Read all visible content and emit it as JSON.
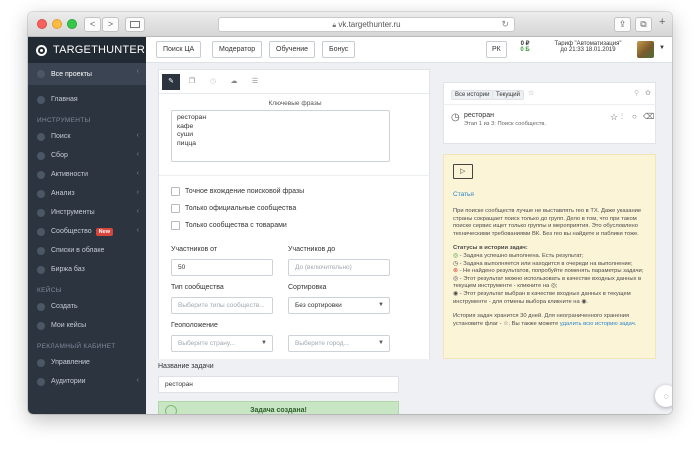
{
  "browser": {
    "url": "vk.targethunter.ru",
    "nav_back": "<",
    "nav_forward": ">",
    "share_glyph": "⇪",
    "tabs_glyph": "⧉",
    "plus": "+"
  },
  "sidebar": {
    "logo": "TARGETHUNTER",
    "all_projects": "Все проекты",
    "home": "Главная",
    "tools_head": "ИНСТРУМЕНТЫ",
    "items": [
      "Поиск",
      "Сбор",
      "Активности",
      "Анализ",
      "Инструменты",
      "Сообщество",
      "Списки в облаке",
      "Биржа баз"
    ],
    "new_badge": "New",
    "cases_head": "КЕЙСЫ",
    "create": "Создать",
    "my_cases": "Мои кейсы",
    "ads_head": "РЕКЛАМНЫЙ КАБИНЕТ",
    "manage": "Управление",
    "audiences": "Аудитории"
  },
  "topbar": {
    "buttons": [
      "Поиск ЦА",
      "Модератор",
      "Обучение",
      "Бонус"
    ],
    "rk": "РК",
    "balance": "0 ₽",
    "balance_sub": "0 Б",
    "tariff": "Тариф \"Автоматизация\"",
    "tariff_until": "до 21:33 18.01.2019"
  },
  "form": {
    "keywords_label": "Ключевые фразы",
    "keywords": "ресторан\nкафе\nсуши\nпицца",
    "checkboxes": [
      "Точное вхождение поисковой фразы",
      "Только официальные сообщества",
      "Только сообщества с товарами"
    ],
    "members_from_label": "Участников от",
    "members_from": "50",
    "members_to_label": "Участников до",
    "members_to_placeholder": "До (включительно)",
    "type_label": "Тип сообщества",
    "type_placeholder": "Выберите типы сообществ...",
    "sort_label": "Сортировка",
    "sort_value": "Без сортировки",
    "geo_label": "Геоположение",
    "country_placeholder": "Выберите страну...",
    "city_placeholder": "Выберите город...",
    "task_name_label": "Название задачи",
    "task_name": "ресторан",
    "success": "Задача создана!"
  },
  "history": {
    "tab_all": "Все истории",
    "tab_current": "Текущий",
    "star": "☆",
    "task_title": "ресторан",
    "task_sub": "Этап 1 из 3: Поиск сообществ."
  },
  "info": {
    "link": "Статья",
    "p1": "При поиске сообществ лучше не выставлять гео в ТХ. Даже указание страны сокращает поиск только до групп. Дело в том, что при таком поиске сервис ищет только группы и мероприятия. Это обусловлено техническими требованиями ВК. Без гео вы найдете и паблики тоже.",
    "statuses_title": "Статусы в истории задач:",
    "s1": "- Задача успешно выполнена. Есть результат;",
    "s2": "- Задача выполняется или находится в очереди на выполнение;",
    "s3": "- Не найдено результатов, попробуйте поменять параметры задачи;",
    "s4": "- Этот результат можно использовать в качестве входных данных в текущем инструменте - кликните на",
    "s5": "- Этот результат выбран в качестве входных данных в текущем инструменте - для отмены выбора кликните на",
    "p3a": "История задач хранится 30 дней. Для неограниченного хранения установите флаг -",
    "p3b": ". Вы также можете",
    "p3link": "удалить всю историю задач."
  },
  "colors": {
    "sidebar": "#2c3440",
    "accent": "#2a86c9",
    "success_bg": "#c8e6c4",
    "info_bg": "#fcf4d7"
  }
}
